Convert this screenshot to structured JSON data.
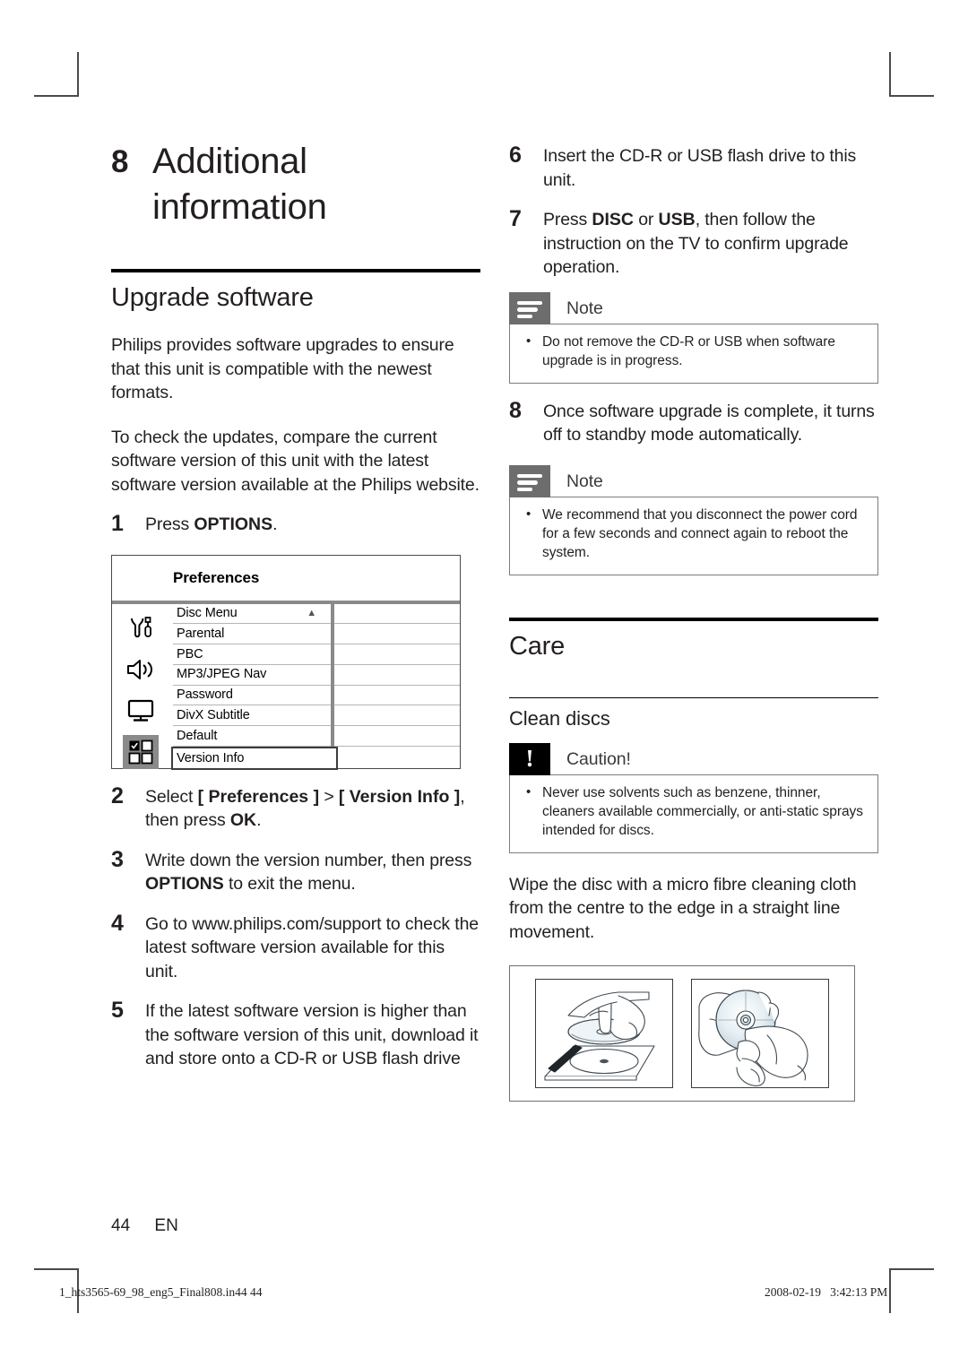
{
  "chapter": {
    "number": "8",
    "title_line1": "Additional",
    "title_line2": "information"
  },
  "left_column": {
    "section_heading": "Upgrade software",
    "intro_paragraph_1": "Philips provides software upgrades to ensure that this unit is compatible with the newest formats.",
    "intro_paragraph_2": "To check the updates, compare the current software version of this unit with the latest software version available at the Philips website.",
    "steps": [
      {
        "num": "1",
        "text": "Press ",
        "bold": "OPTIONS",
        "tail": "."
      },
      {
        "num": "2",
        "text_parts": [
          {
            "t": "Select ",
            "b": false
          },
          {
            "t": "[ Preferences ]",
            "b": true
          },
          {
            "t": " > ",
            "b": false
          },
          {
            "t": "[ Version Info ]",
            "b": true
          },
          {
            "t": ", then press ",
            "b": false
          },
          {
            "t": "OK",
            "b": true
          },
          {
            "t": ".",
            "b": false
          }
        ]
      },
      {
        "num": "3",
        "text_parts": [
          {
            "t": "Write down the version number, then press ",
            "b": false
          },
          {
            "t": "OPTIONS",
            "b": true
          },
          {
            "t": " to exit the menu.",
            "b": false
          }
        ]
      },
      {
        "num": "4",
        "text_parts": [
          {
            "t": "Go to www.philips.com/support to check the latest software version available for this unit.",
            "b": false
          }
        ]
      },
      {
        "num": "5",
        "text_parts": [
          {
            "t": "If the latest software version is higher than the software version of this unit, download it and store onto a CD-R or USB flash drive",
            "b": false
          }
        ]
      }
    ],
    "osd": {
      "title": "Preferences",
      "icons": [
        "tools-icon",
        "speaker-icon",
        "tv-icon",
        "grid-icon"
      ],
      "selected_icon_index": 3,
      "menu_items": [
        "Disc Menu",
        "Parental",
        "PBC",
        "MP3/JPEG Nav",
        "Password",
        "DivX Subtitle",
        "Default",
        "Version Info"
      ],
      "highlighted_item": "Version Info",
      "caret_on_item": "Disc Menu",
      "caret_glyph": "▲"
    }
  },
  "right_column": {
    "steps": [
      {
        "num": "6",
        "text_parts": [
          {
            "t": "Insert the CD-R or USB flash drive to this unit.",
            "b": false
          }
        ]
      },
      {
        "num": "7",
        "text_parts": [
          {
            "t": "Press ",
            "b": false
          },
          {
            "t": "DISC",
            "b": true
          },
          {
            "t": " or ",
            "b": false
          },
          {
            "t": "USB",
            "b": true
          },
          {
            "t": ", then follow the instruction on the TV to confirm upgrade operation.",
            "b": false
          }
        ]
      },
      {
        "num": "8",
        "text_parts": [
          {
            "t": "Once software upgrade is complete, it turns off to standby mode automatically.",
            "b": false
          }
        ]
      }
    ],
    "note_1": {
      "label": "Note",
      "icon": "note-icon",
      "bullets": [
        "Do not remove the CD-R or USB when software upgrade is in progress."
      ]
    },
    "note_2": {
      "label": "Note",
      "icon": "note-icon",
      "bullets": [
        "We recommend that you disconnect the power cord for a few seconds and connect again to reboot the system."
      ]
    },
    "care_heading": "Care",
    "clean_discs_heading": "Clean discs",
    "caution": {
      "label": "Caution!",
      "icon": "caution-icon",
      "bullets": [
        "Never use solvents such as benzene, thinner, cleaners available commercially, or anti-static sprays intended for discs."
      ]
    },
    "wipe_paragraph": "Wipe the disc with a micro fibre cleaning cloth from the centre to the edge in a straight line movement.",
    "illustration": {
      "panel_1": "hand-removing-disc-from-tray",
      "panel_2": "hand-wiping-disc-with-cloth"
    }
  },
  "footer": {
    "page_number": "44",
    "language_code": "EN",
    "print_filename": "1_hts3565-69_98_eng5_Final808.in44   44",
    "print_timestamp": "2008-02-19   3:42:13 PM"
  },
  "colors": {
    "text": "#231f20",
    "note_badge": "#6d6d6d",
    "caution_badge": "#000000",
    "osd_divider": "#8a8a8a",
    "rule": "#000000"
  }
}
